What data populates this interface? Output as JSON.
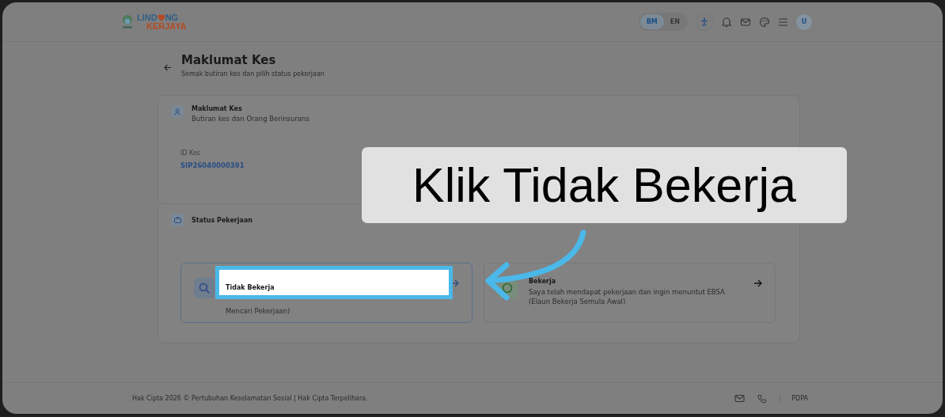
{
  "header": {
    "logo_top_start": "LIND",
    "logo_top_end": "NG",
    "logo_bottom": "KERJAYA",
    "languages": [
      {
        "label": "BM",
        "selected": true
      },
      {
        "label": "EN",
        "selected": false
      }
    ],
    "avatar": "U"
  },
  "page": {
    "title": "Maklumat Kes",
    "subtitle": "Semak butiran kes dan pilih status pekerjaan"
  },
  "case_card": {
    "title": "Maklumat Kes",
    "subtitle": "Butiran kes dan Orang Berinsurans",
    "fields": [
      {
        "label": "ID Kes",
        "value": "SIP26040000391"
      }
    ]
  },
  "status_card": {
    "title": "Status Pekerjaan",
    "options": [
      {
        "kind": "search",
        "title": "Tidak Bekerja",
        "description": "Mencari Pekerjaan)",
        "selected": true,
        "highlighted": true
      },
      {
        "kind": "check",
        "title": "Bekerja",
        "description": "Saya telah mendapat pekerjaan dan ingin menuntut EBSA (Elaun Bekerja Semula Awal)",
        "selected": false,
        "highlighted": false
      }
    ]
  },
  "callout": {
    "text": "Klik Tidak Bekerja"
  },
  "footer": {
    "copyright": "Hak Cipta 2026 © Pertubuhan Keselamatan Sosial | Hak Cipta Terpelihara.",
    "pdpa": "PDPA"
  }
}
